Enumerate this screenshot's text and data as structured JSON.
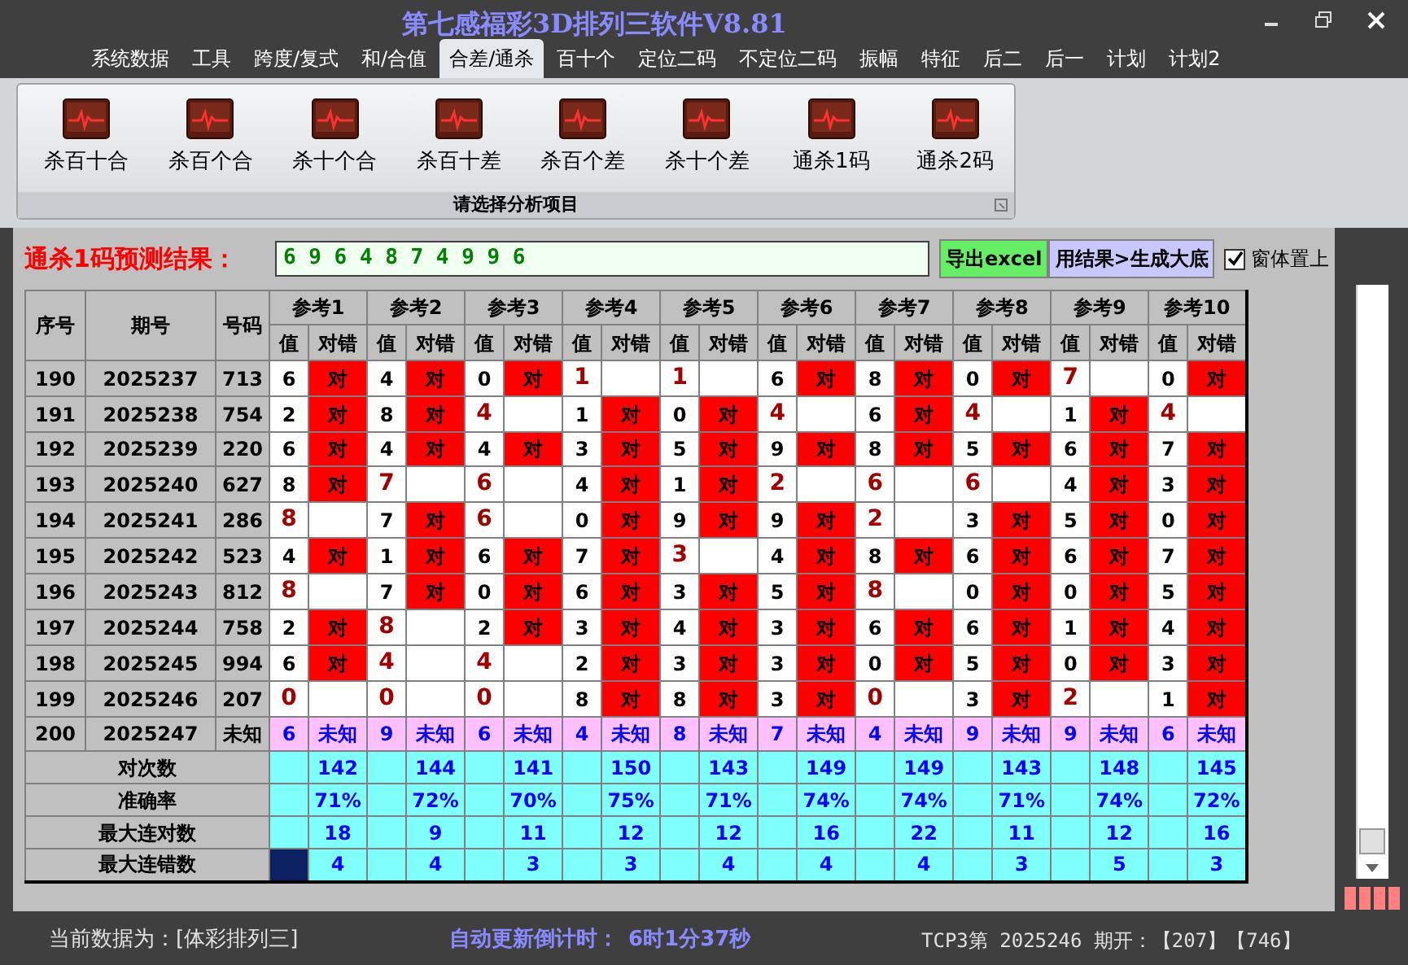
{
  "window": {
    "title": "第七感福彩3D排列三软件V8.81"
  },
  "menu": [
    {
      "label": "系统数据",
      "selected": false
    },
    {
      "label": "工具",
      "selected": false
    },
    {
      "label": "跨度/复式",
      "selected": false
    },
    {
      "label": "和/合值",
      "selected": false
    },
    {
      "label": "合差/通杀",
      "selected": true
    },
    {
      "label": "百十个",
      "selected": false
    },
    {
      "label": "定位二码",
      "selected": false
    },
    {
      "label": "不定位二码",
      "selected": false
    },
    {
      "label": "振幅",
      "selected": false
    },
    {
      "label": "特征",
      "selected": false
    },
    {
      "label": "后二",
      "selected": false
    },
    {
      "label": "后一",
      "selected": false
    },
    {
      "label": "计划",
      "selected": false
    },
    {
      "label": "计划2",
      "selected": false
    }
  ],
  "ribbon": {
    "items": [
      {
        "label": "杀百十合"
      },
      {
        "label": "杀百个合"
      },
      {
        "label": "杀十个合"
      },
      {
        "label": "杀百十差"
      },
      {
        "label": "杀百个差"
      },
      {
        "label": "杀十个差"
      },
      {
        "label": "通杀1码"
      },
      {
        "label": "通杀2码"
      }
    ],
    "group_label": "请选择分析项目"
  },
  "prediction": {
    "label": "通杀1码预测结果：",
    "value": "6 9 6 4 8 7 4 9 9 6",
    "buttons": [
      {
        "label": "导出excel",
        "kind": "export"
      },
      {
        "label": "用结果>生成大底",
        "kind": "generate"
      }
    ],
    "checkbox": {
      "label": "窗体置上",
      "checked": true
    }
  },
  "table": {
    "columns": [
      "序号",
      "期号",
      "号码"
    ],
    "refs": [
      {
        "label": "参考1",
        "sub": [
          "值",
          "对错"
        ]
      },
      {
        "label": "参考2",
        "sub": [
          "值",
          "对错"
        ]
      },
      {
        "label": "参考3",
        "sub": [
          "值",
          "对错"
        ]
      },
      {
        "label": "参考4",
        "sub": [
          "值",
          "对错"
        ]
      },
      {
        "label": "参考5",
        "sub": [
          "值",
          "对错"
        ]
      },
      {
        "label": "参考6",
        "sub": [
          "值",
          "对错"
        ]
      },
      {
        "label": "参考7",
        "sub": [
          "值",
          "对错"
        ]
      },
      {
        "label": "参考8",
        "sub": [
          "值",
          "对错"
        ]
      },
      {
        "label": "参考9",
        "sub": [
          "值",
          "对错"
        ]
      },
      {
        "label": "参考10",
        "sub": [
          "值",
          "对错"
        ]
      }
    ],
    "rows": [
      {
        "no": "190",
        "period": "2025237",
        "number": "713",
        "kind": "result",
        "cells": [
          {
            "value": "6",
            "hit": true,
            "mark": "对"
          },
          {
            "value": "4",
            "hit": true,
            "mark": "对"
          },
          {
            "value": "0",
            "hit": true,
            "mark": "对"
          },
          {
            "value": "1",
            "hit": false
          },
          {
            "value": "1",
            "hit": false
          },
          {
            "value": "6",
            "hit": true,
            "mark": "对"
          },
          {
            "value": "8",
            "hit": true,
            "mark": "对"
          },
          {
            "value": "0",
            "hit": true,
            "mark": "对"
          },
          {
            "value": "7",
            "hit": false
          },
          {
            "value": "0",
            "hit": true,
            "mark": "对"
          }
        ]
      },
      {
        "no": "191",
        "period": "2025238",
        "number": "754",
        "kind": "result",
        "cells": [
          {
            "value": "2",
            "hit": true,
            "mark": "对"
          },
          {
            "value": "8",
            "hit": true,
            "mark": "对"
          },
          {
            "value": "4",
            "hit": false
          },
          {
            "value": "1",
            "hit": true,
            "mark": "对"
          },
          {
            "value": "0",
            "hit": true,
            "mark": "对"
          },
          {
            "value": "4",
            "hit": false
          },
          {
            "value": "6",
            "hit": true,
            "mark": "对"
          },
          {
            "value": "4",
            "hit": false
          },
          {
            "value": "1",
            "hit": true,
            "mark": "对"
          },
          {
            "value": "4",
            "hit": false
          }
        ]
      },
      {
        "no": "192",
        "period": "2025239",
        "number": "220",
        "kind": "result",
        "cells": [
          {
            "value": "6",
            "hit": true,
            "mark": "对"
          },
          {
            "value": "4",
            "hit": true,
            "mark": "对"
          },
          {
            "value": "4",
            "hit": true,
            "mark": "对"
          },
          {
            "value": "3",
            "hit": true,
            "mark": "对"
          },
          {
            "value": "5",
            "hit": true,
            "mark": "对"
          },
          {
            "value": "9",
            "hit": true,
            "mark": "对"
          },
          {
            "value": "8",
            "hit": true,
            "mark": "对"
          },
          {
            "value": "5",
            "hit": true,
            "mark": "对"
          },
          {
            "value": "6",
            "hit": true,
            "mark": "对"
          },
          {
            "value": "7",
            "hit": true,
            "mark": "对"
          }
        ]
      },
      {
        "no": "193",
        "period": "2025240",
        "number": "627",
        "kind": "result",
        "cells": [
          {
            "value": "8",
            "hit": true,
            "mark": "对"
          },
          {
            "value": "7",
            "hit": false
          },
          {
            "value": "6",
            "hit": false
          },
          {
            "value": "4",
            "hit": true,
            "mark": "对"
          },
          {
            "value": "1",
            "hit": true,
            "mark": "对"
          },
          {
            "value": "2",
            "hit": false
          },
          {
            "value": "6",
            "hit": false
          },
          {
            "value": "6",
            "hit": false
          },
          {
            "value": "4",
            "hit": true,
            "mark": "对"
          },
          {
            "value": "3",
            "hit": true,
            "mark": "对"
          }
        ]
      },
      {
        "no": "194",
        "period": "2025241",
        "number": "286",
        "kind": "result",
        "cells": [
          {
            "value": "8",
            "hit": false
          },
          {
            "value": "7",
            "hit": true,
            "mark": "对"
          },
          {
            "value": "6",
            "hit": false
          },
          {
            "value": "0",
            "hit": true,
            "mark": "对"
          },
          {
            "value": "9",
            "hit": true,
            "mark": "对"
          },
          {
            "value": "9",
            "hit": true,
            "mark": "对"
          },
          {
            "value": "2",
            "hit": false
          },
          {
            "value": "3",
            "hit": true,
            "mark": "对"
          },
          {
            "value": "5",
            "hit": true,
            "mark": "对"
          },
          {
            "value": "0",
            "hit": true,
            "mark": "对"
          }
        ]
      },
      {
        "no": "195",
        "period": "2025242",
        "number": "523",
        "kind": "result",
        "cells": [
          {
            "value": "4",
            "hit": true,
            "mark": "对"
          },
          {
            "value": "1",
            "hit": true,
            "mark": "对"
          },
          {
            "value": "6",
            "hit": true,
            "mark": "对"
          },
          {
            "value": "7",
            "hit": true,
            "mark": "对"
          },
          {
            "value": "3",
            "hit": false
          },
          {
            "value": "4",
            "hit": true,
            "mark": "对"
          },
          {
            "value": "8",
            "hit": true,
            "mark": "对"
          },
          {
            "value": "6",
            "hit": true,
            "mark": "对"
          },
          {
            "value": "6",
            "hit": true,
            "mark": "对"
          },
          {
            "value": "7",
            "hit": true,
            "mark": "对"
          }
        ]
      },
      {
        "no": "196",
        "period": "2025243",
        "number": "812",
        "kind": "result",
        "cells": [
          {
            "value": "8",
            "hit": false
          },
          {
            "value": "7",
            "hit": true,
            "mark": "对"
          },
          {
            "value": "0",
            "hit": true,
            "mark": "对"
          },
          {
            "value": "6",
            "hit": true,
            "mark": "对"
          },
          {
            "value": "3",
            "hit": true,
            "mark": "对"
          },
          {
            "value": "5",
            "hit": true,
            "mark": "对"
          },
          {
            "value": "8",
            "hit": false
          },
          {
            "value": "0",
            "hit": true,
            "mark": "对"
          },
          {
            "value": "0",
            "hit": true,
            "mark": "对"
          },
          {
            "value": "5",
            "hit": true,
            "mark": "对"
          }
        ]
      },
      {
        "no": "197",
        "period": "2025244",
        "number": "758",
        "kind": "result",
        "cells": [
          {
            "value": "2",
            "hit": true,
            "mark": "对"
          },
          {
            "value": "8",
            "hit": false
          },
          {
            "value": "2",
            "hit": true,
            "mark": "对"
          },
          {
            "value": "3",
            "hit": true,
            "mark": "对"
          },
          {
            "value": "4",
            "hit": true,
            "mark": "对"
          },
          {
            "value": "3",
            "hit": true,
            "mark": "对"
          },
          {
            "value": "6",
            "hit": true,
            "mark": "对"
          },
          {
            "value": "6",
            "hit": true,
            "mark": "对"
          },
          {
            "value": "1",
            "hit": true,
            "mark": "对"
          },
          {
            "value": "4",
            "hit": true,
            "mark": "对"
          }
        ]
      },
      {
        "no": "198",
        "period": "2025245",
        "number": "994",
        "kind": "result",
        "cells": [
          {
            "value": "6",
            "hit": true,
            "mark": "对"
          },
          {
            "value": "4",
            "hit": false
          },
          {
            "value": "4",
            "hit": false
          },
          {
            "value": "2",
            "hit": true,
            "mark": "对"
          },
          {
            "value": "3",
            "hit": true,
            "mark": "对"
          },
          {
            "value": "3",
            "hit": true,
            "mark": "对"
          },
          {
            "value": "0",
            "hit": true,
            "mark": "对"
          },
          {
            "value": "5",
            "hit": true,
            "mark": "对"
          },
          {
            "value": "0",
            "hit": true,
            "mark": "对"
          },
          {
            "value": "3",
            "hit": true,
            "mark": "对"
          }
        ]
      },
      {
        "no": "199",
        "period": "2025246",
        "number": "207",
        "kind": "result",
        "cells": [
          {
            "value": "0",
            "hit": false
          },
          {
            "value": "0",
            "hit": false
          },
          {
            "value": "0",
            "hit": false
          },
          {
            "value": "8",
            "hit": true,
            "mark": "对"
          },
          {
            "value": "8",
            "hit": true,
            "mark": "对"
          },
          {
            "value": "3",
            "hit": true,
            "mark": "对"
          },
          {
            "value": "0",
            "hit": false
          },
          {
            "value": "3",
            "hit": true,
            "mark": "对"
          },
          {
            "value": "2",
            "hit": false
          },
          {
            "value": "1",
            "hit": true,
            "mark": "对"
          }
        ]
      },
      {
        "no": "200",
        "period": "2025247",
        "number": "未知",
        "kind": "pending",
        "cells": [
          {
            "value": "6",
            "mark": "未知"
          },
          {
            "value": "9",
            "mark": "未知"
          },
          {
            "value": "6",
            "mark": "未知"
          },
          {
            "value": "4",
            "mark": "未知"
          },
          {
            "value": "8",
            "mark": "未知"
          },
          {
            "value": "7",
            "mark": "未知"
          },
          {
            "value": "4",
            "mark": "未知"
          },
          {
            "value": "9",
            "mark": "未知"
          },
          {
            "value": "9",
            "mark": "未知"
          },
          {
            "value": "6",
            "mark": "未知"
          }
        ]
      }
    ],
    "stats": [
      {
        "label": "对次数",
        "selected": false,
        "values": [
          "142",
          "144",
          "141",
          "150",
          "143",
          "149",
          "149",
          "143",
          "148",
          "145"
        ]
      },
      {
        "label": "准确率",
        "selected": false,
        "values": [
          "71%",
          "72%",
          "70%",
          "75%",
          "71%",
          "74%",
          "74%",
          "71%",
          "74%",
          "72%"
        ]
      },
      {
        "label": "最大连对数",
        "selected": false,
        "values": [
          "18",
          "9",
          "11",
          "12",
          "12",
          "16",
          "22",
          "11",
          "12",
          "16"
        ]
      },
      {
        "label": "最大连错数",
        "selected": true,
        "values": [
          "4",
          "4",
          "3",
          "3",
          "4",
          "4",
          "4",
          "3",
          "5",
          "3"
        ]
      }
    ]
  },
  "status_bar": {
    "source": "当前数据为：[体彩排列三]",
    "countdown_label": "自动更新倒计时：",
    "countdown": "6时1分37秒",
    "draw_info": "TCP3第 2025246 期开：【207】【746】"
  }
}
